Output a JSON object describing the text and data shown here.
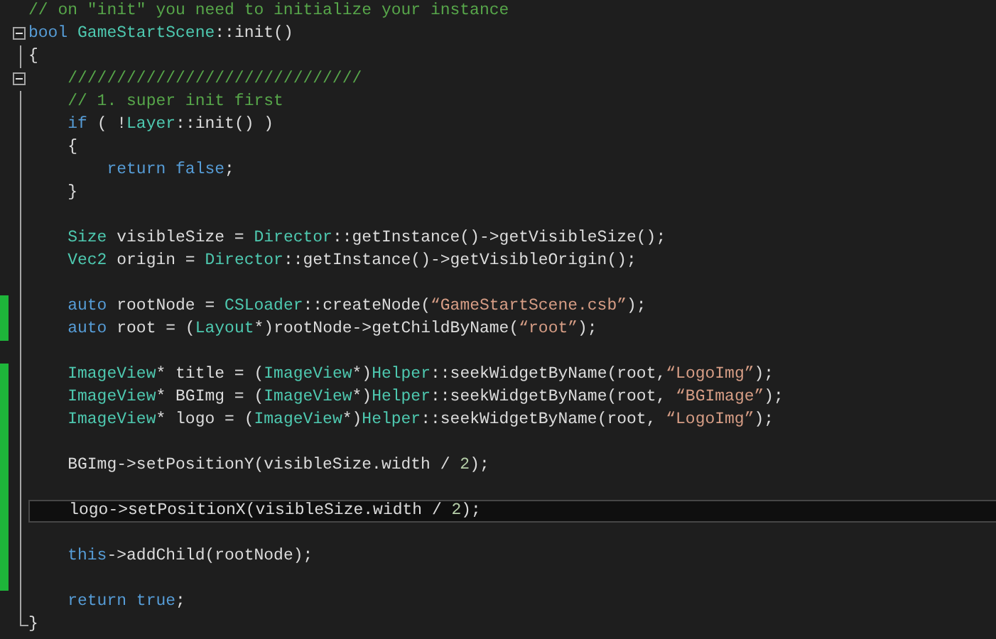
{
  "editor": {
    "lines": [
      {
        "changed": false,
        "current": false,
        "tokens": [
          {
            "kind": "comment",
            "text": "// on \"init\" you need to initialize your instance"
          }
        ]
      },
      {
        "changed": false,
        "current": false,
        "expanded": true,
        "tokens": [
          {
            "kind": "keyword",
            "text": "bool"
          },
          {
            "kind": "type",
            "text": " GameStartScene"
          },
          {
            "kind": "plain",
            "text": "::init()"
          }
        ]
      },
      {
        "changed": false,
        "current": false,
        "tokens": [
          {
            "kind": "plain",
            "text": "{"
          }
        ]
      },
      {
        "changed": false,
        "current": false,
        "expanded": true,
        "tokens": [
          {
            "kind": "comment",
            "text": "    //////////////////////////////"
          }
        ]
      },
      {
        "changed": false,
        "current": false,
        "tokens": [
          {
            "kind": "comment",
            "text": "    // 1. super init first"
          }
        ]
      },
      {
        "changed": false,
        "current": false,
        "tokens": [
          {
            "kind": "keyword",
            "text": "    if"
          },
          {
            "kind": "plain",
            "text": " ( !"
          },
          {
            "kind": "type",
            "text": "Layer"
          },
          {
            "kind": "plain",
            "text": "::init() )"
          }
        ]
      },
      {
        "changed": false,
        "current": false,
        "tokens": [
          {
            "kind": "plain",
            "text": "    {"
          }
        ]
      },
      {
        "changed": false,
        "current": false,
        "tokens": [
          {
            "kind": "keyword",
            "text": "        return false"
          },
          {
            "kind": "plain",
            "text": ";"
          }
        ]
      },
      {
        "changed": false,
        "current": false,
        "tokens": [
          {
            "kind": "plain",
            "text": "    }"
          }
        ]
      },
      {
        "changed": false,
        "current": false
      },
      {
        "changed": false,
        "current": false,
        "tokens": [
          {
            "kind": "type",
            "text": "    Size"
          },
          {
            "kind": "plain",
            "text": " visibleSize = "
          },
          {
            "kind": "type",
            "text": "Director"
          },
          {
            "kind": "plain",
            "text": "::getInstance()->getVisibleSize();"
          }
        ]
      },
      {
        "changed": false,
        "current": false,
        "tokens": [
          {
            "kind": "type",
            "text": "    Vec2"
          },
          {
            "kind": "plain",
            "text": " origin = "
          },
          {
            "kind": "type",
            "text": "Director"
          },
          {
            "kind": "plain",
            "text": "::getInstance()->getVisibleOrigin();"
          }
        ]
      },
      {
        "changed": false,
        "current": false
      },
      {
        "changed": true,
        "current": false,
        "tokens": [
          {
            "kind": "keyword",
            "text": "    auto"
          },
          {
            "kind": "plain",
            "text": " rootNode = "
          },
          {
            "kind": "type",
            "text": "CSLoader"
          },
          {
            "kind": "plain",
            "text": "::createNode("
          },
          {
            "kind": "string",
            "text": "“GameStartScene.csb”"
          },
          {
            "kind": "plain",
            "text": ");"
          }
        ]
      },
      {
        "changed": true,
        "current": false,
        "tokens": [
          {
            "kind": "keyword",
            "text": "    auto"
          },
          {
            "kind": "plain",
            "text": " root = ("
          },
          {
            "kind": "type",
            "text": "Layout"
          },
          {
            "kind": "plain",
            "text": "*)rootNode->getChildByName("
          },
          {
            "kind": "string",
            "text": "“root”"
          },
          {
            "kind": "plain",
            "text": ");"
          }
        ]
      },
      {
        "changed": false,
        "current": false
      },
      {
        "changed": true,
        "current": false,
        "tokens": [
          {
            "kind": "type",
            "text": "    ImageView"
          },
          {
            "kind": "plain",
            "text": "* title = ("
          },
          {
            "kind": "type",
            "text": "ImageView"
          },
          {
            "kind": "plain",
            "text": "*)"
          },
          {
            "kind": "type",
            "text": "Helper"
          },
          {
            "kind": "plain",
            "text": "::seekWidgetByName(root,"
          },
          {
            "kind": "string",
            "text": "“LogoImg”"
          },
          {
            "kind": "plain",
            "text": ");"
          }
        ]
      },
      {
        "changed": true,
        "current": false,
        "tokens": [
          {
            "kind": "type",
            "text": "    ImageView"
          },
          {
            "kind": "plain",
            "text": "* BGImg = ("
          },
          {
            "kind": "type",
            "text": "ImageView"
          },
          {
            "kind": "plain",
            "text": "*)"
          },
          {
            "kind": "type",
            "text": "Helper"
          },
          {
            "kind": "plain",
            "text": "::seekWidgetByName(root, "
          },
          {
            "kind": "string",
            "text": "“BGImage”"
          },
          {
            "kind": "plain",
            "text": ");"
          }
        ]
      },
      {
        "changed": true,
        "current": false,
        "tokens": [
          {
            "kind": "type",
            "text": "    ImageView"
          },
          {
            "kind": "plain",
            "text": "* logo = ("
          },
          {
            "kind": "type",
            "text": "ImageView"
          },
          {
            "kind": "plain",
            "text": "*)"
          },
          {
            "kind": "type",
            "text": "Helper"
          },
          {
            "kind": "plain",
            "text": "::seekWidgetByName(root, "
          },
          {
            "kind": "string",
            "text": "“LogoImg”"
          },
          {
            "kind": "plain",
            "text": ");"
          }
        ]
      },
      {
        "changed": true,
        "current": false
      },
      {
        "changed": true,
        "current": false,
        "tokens": [
          {
            "kind": "plain",
            "text": "    BGImg->setPositionY(visibleSize.width / "
          },
          {
            "kind": "number",
            "text": "2"
          },
          {
            "kind": "plain",
            "text": ");"
          }
        ]
      },
      {
        "changed": true,
        "current": false
      },
      {
        "changed": true,
        "current": true,
        "tokens": [
          {
            "kind": "plain",
            "text": "    logo->setPositionX(visibleSize.width / "
          },
          {
            "kind": "number",
            "text": "2"
          },
          {
            "kind": "plain",
            "text": ");"
          }
        ]
      },
      {
        "changed": true,
        "current": false
      },
      {
        "changed": true,
        "current": false,
        "tokens": [
          {
            "kind": "keyword",
            "text": "    this"
          },
          {
            "kind": "plain",
            "text": "->addChild(rootNode);"
          }
        ]
      },
      {
        "changed": true,
        "current": false
      },
      {
        "changed": false,
        "current": false,
        "tokens": [
          {
            "kind": "keyword",
            "text": "    return true"
          },
          {
            "kind": "plain",
            "text": ";"
          }
        ]
      },
      {
        "changed": false,
        "current": false,
        "tokens": [
          {
            "kind": "plain",
            "text": "}"
          }
        ]
      }
    ]
  }
}
